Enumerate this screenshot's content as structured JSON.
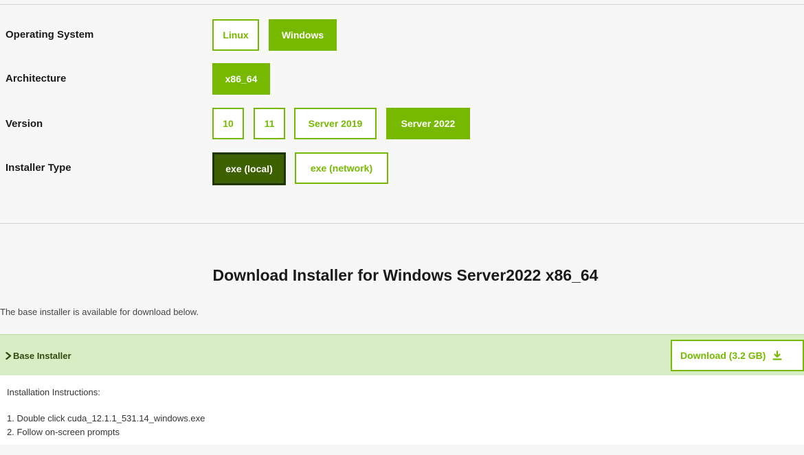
{
  "selector": {
    "rows": [
      {
        "label": "Operating System",
        "options": [
          "Linux",
          "Windows"
        ],
        "selected": "Windows"
      },
      {
        "label": "Architecture",
        "options": [
          "x86_64"
        ],
        "selected": "x86_64"
      },
      {
        "label": "Version",
        "options": [
          "10",
          "11",
          "Server 2019",
          "Server 2022"
        ],
        "selected": "Server 2022"
      },
      {
        "label": "Installer Type",
        "options": [
          "exe (local)",
          "exe (network)"
        ],
        "selected": "exe (local)"
      }
    ]
  },
  "download": {
    "title": "Download Installer for Windows Server2022 x86_64",
    "note": "The base installer is available for download below.",
    "installer_label": "Base Installer",
    "button_label": "Download (3.2 GB)",
    "button_icon": "download-icon",
    "instructions_heading": "Installation Instructions:",
    "steps": [
      "1. Double click cuda_12.1.1_531.14_windows.exe",
      "2. Follow on-screen prompts"
    ]
  },
  "colors": {
    "accent": "#76b900",
    "accent_dark": "#3d6000",
    "installer_bar_bg": "#d9edc4"
  }
}
